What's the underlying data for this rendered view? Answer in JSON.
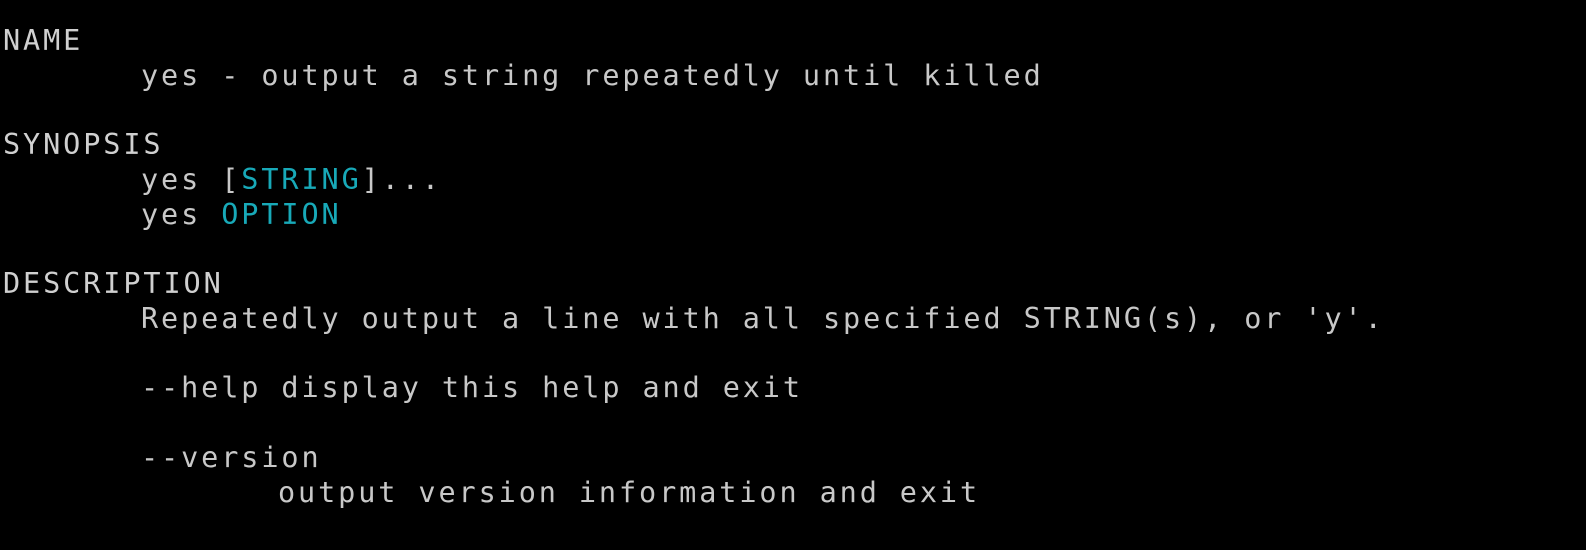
{
  "colors": {
    "background": "#000000",
    "text": "#c8c8c8",
    "highlight": "#18a9b8"
  },
  "man_page": {
    "name": {
      "heading": "NAME",
      "text": "yes - output a string repeatedly until killed"
    },
    "synopsis": {
      "heading": "SYNOPSIS",
      "line1": {
        "cmd": "yes ",
        "open": "[",
        "arg": "STRING",
        "rest": "]..."
      },
      "line2": {
        "cmd": "yes ",
        "arg": "OPTION"
      }
    },
    "description": {
      "heading": "DESCRIPTION",
      "text": "Repeatedly output a line with all specified STRING(s), or 'y'.",
      "help_option": "--help display this help and exit",
      "version_option": "--version",
      "version_desc": "output version information and exit"
    }
  }
}
